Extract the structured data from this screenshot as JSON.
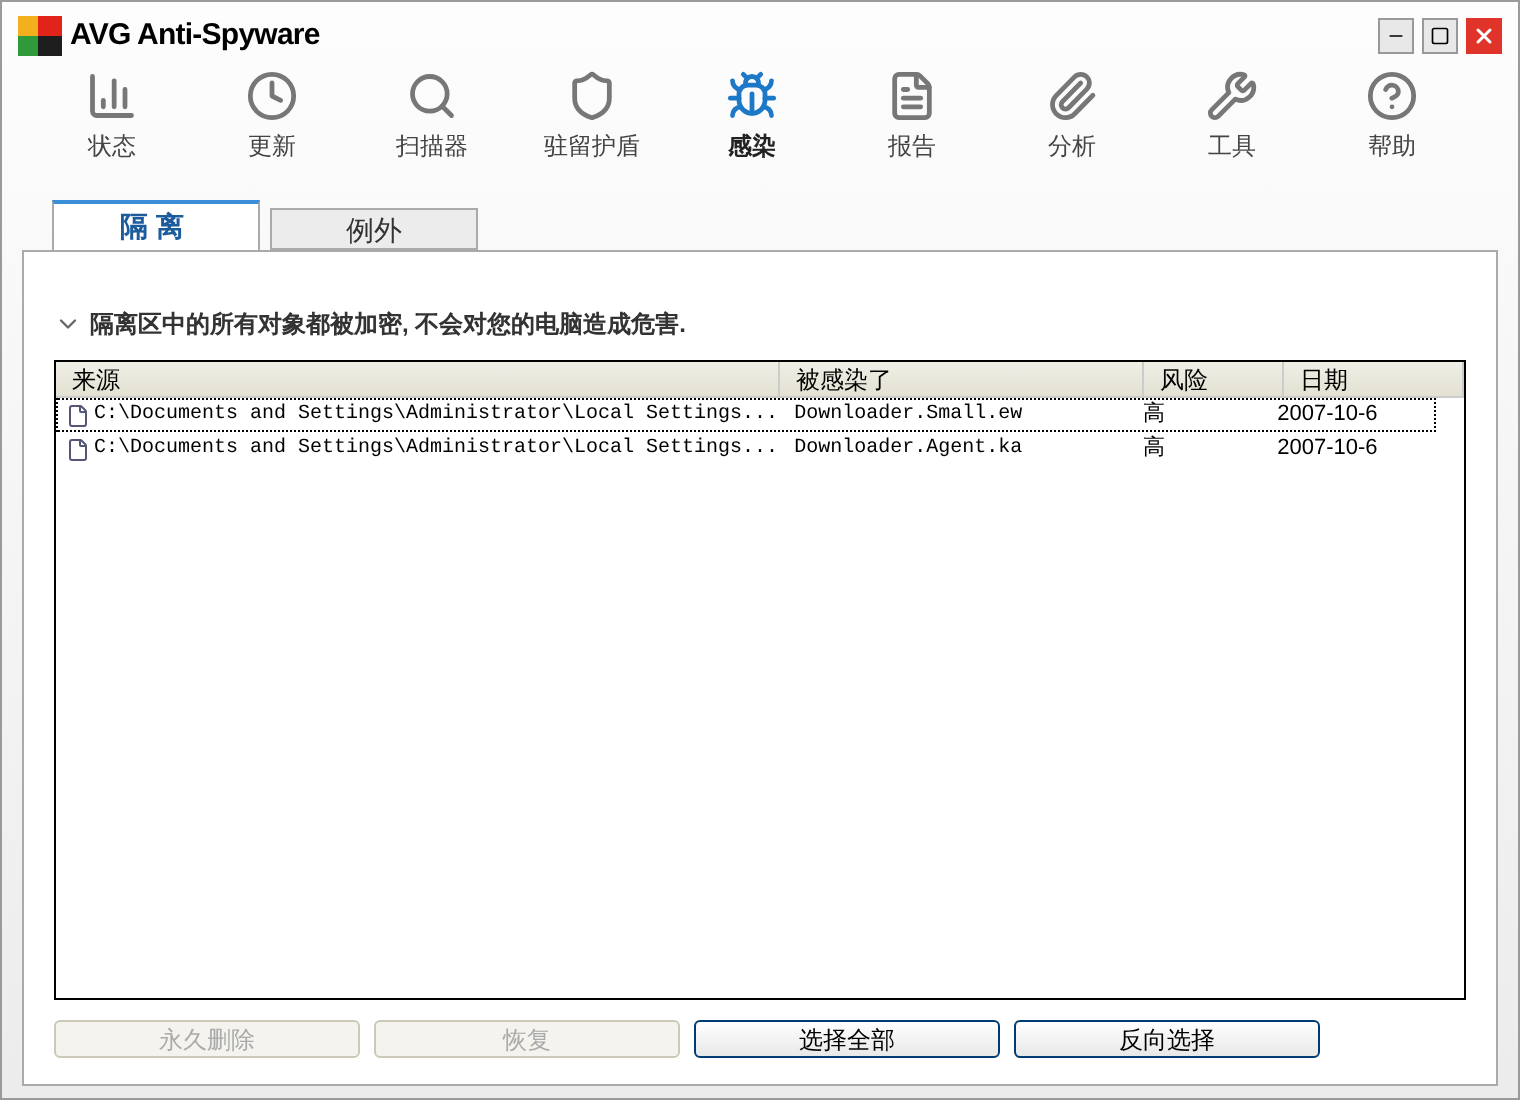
{
  "window": {
    "title": "AVG Anti-Spyware"
  },
  "nav": [
    {
      "label": "状态",
      "kind": "status",
      "selected": false
    },
    {
      "label": "更新",
      "kind": "update",
      "selected": false
    },
    {
      "label": "扫描器",
      "kind": "scanner",
      "selected": false
    },
    {
      "label": "驻留护盾",
      "kind": "shield",
      "selected": false
    },
    {
      "label": "感染",
      "kind": "infection",
      "selected": true
    },
    {
      "label": "报告",
      "kind": "report",
      "selected": false
    },
    {
      "label": "分析",
      "kind": "analysis",
      "selected": false
    },
    {
      "label": "工具",
      "kind": "tools",
      "selected": false
    },
    {
      "label": "帮助",
      "kind": "help",
      "selected": false
    }
  ],
  "tabs": [
    {
      "label": "隔离",
      "selected": true
    },
    {
      "label": "例外",
      "selected": false
    }
  ],
  "info": "隔离区中的所有对象都被加密, 不会对您的电脑造成危害.",
  "table": {
    "columns": [
      "来源",
      "被感染了",
      "风险",
      "日期"
    ],
    "rows": [
      {
        "cells": [
          "C:\\Documents and Settings\\Administrator\\Local Settings...",
          "Downloader.Small.ew",
          "高",
          "2007-10-6"
        ],
        "selected": true
      },
      {
        "cells": [
          "C:\\Documents and Settings\\Administrator\\Local Settings...",
          "Downloader.Agent.ka",
          "高",
          "2007-10-6"
        ],
        "selected": false
      }
    ]
  },
  "buttons": [
    {
      "label": "永久删除",
      "disabled": true
    },
    {
      "label": "恢复",
      "disabled": true
    },
    {
      "label": "选择全部",
      "disabled": false
    },
    {
      "label": "反向选择",
      "disabled": false
    }
  ]
}
